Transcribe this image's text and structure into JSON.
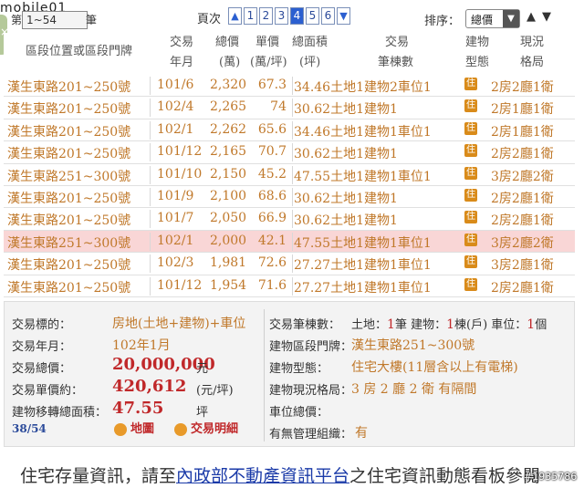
{
  "logo": "mobile01",
  "page_select": {
    "prefix": "第",
    "value": "1~54",
    "suffix": "筆"
  },
  "left_tab": "×",
  "pager": {
    "label": "頁次",
    "prev": "▲",
    "pages": [
      "1",
      "2",
      "3",
      "4",
      "5",
      "6"
    ],
    "current": "4",
    "next": "▼"
  },
  "sort": {
    "label": "排序：",
    "value": "總價",
    "arrow": "▼",
    "asc": "▲",
    "desc": "▼"
  },
  "headers": {
    "addr": "區段位置或區段門牌",
    "date_1": "交易",
    "date_2": "年月",
    "price_1": "總價",
    "price_2": "(萬)",
    "unit_1": "單價",
    "unit_2": "(萬/坪)",
    "area_1": "總面積",
    "area_2": "(坪)",
    "count_1": "交易",
    "count_2": "筆棟數",
    "type_1": "建物",
    "type_2": "型態",
    "layout_1": "現況",
    "layout_2": "格局"
  },
  "rows": [
    {
      "addr": "漢生東路201~250號",
      "date": "101/6",
      "price": "2,320",
      "unit": "67.3",
      "area": "34.46",
      "count": "土地1建物2車位1",
      "type": "住",
      "layout": "2房2廳1衛"
    },
    {
      "addr": "漢生東路201~250號",
      "date": "102/4",
      "price": "2,265",
      "unit": "74",
      "area": "30.62",
      "count": "土地1建物1",
      "type": "住",
      "layout": "2房1廳1衛"
    },
    {
      "addr": "漢生東路201~250號",
      "date": "102/1",
      "price": "2,262",
      "unit": "65.6",
      "area": "34.46",
      "count": "土地1建物1車位1",
      "type": "住",
      "layout": "2房1廳1衛"
    },
    {
      "addr": "漢生東路201~250號",
      "date": "101/12",
      "price": "2,165",
      "unit": "70.7",
      "area": "30.62",
      "count": "土地1建物1",
      "type": "住",
      "layout": "2房2廳1衛"
    },
    {
      "addr": "漢生東路251~300號",
      "date": "101/10",
      "price": "2,150",
      "unit": "45.2",
      "area": "47.55",
      "count": "土地1建物1車位1",
      "type": "住",
      "layout": "3房2廳2衛"
    },
    {
      "addr": "漢生東路201~250號",
      "date": "101/9",
      "price": "2,100",
      "unit": "68.6",
      "area": "30.62",
      "count": "土地1建物1",
      "type": "住",
      "layout": "2房2廳1衛"
    },
    {
      "addr": "漢生東路201~250號",
      "date": "101/7",
      "price": "2,050",
      "unit": "66.9",
      "area": "30.62",
      "count": "土地1建物1",
      "type": "住",
      "layout": "2房2廳1衛"
    },
    {
      "addr": "漢生東路251~300號",
      "date": "102/1",
      "price": "2,000",
      "unit": "42.1",
      "area": "47.55",
      "count": "土地1建物1車位1",
      "type": "住",
      "layout": "3房2廳2衛",
      "highlight": true
    },
    {
      "addr": "漢生東路201~250號",
      "date": "102/3",
      "price": "1,981",
      "unit": "72.6",
      "area": "27.27",
      "count": "土地1建物1車位1",
      "type": "住",
      "layout": "3房2廳1衛"
    },
    {
      "addr": "漢生東路201~250號",
      "date": "101/12",
      "price": "1,954",
      "unit": "71.6",
      "area": "27.27",
      "count": "土地1建物1車位1",
      "type": "住",
      "layout": "2房2廳1衛"
    }
  ],
  "detail": {
    "target_label": "交易標的：",
    "target_value": "房地(土地+建物)+車位",
    "month_label": "交易年月：",
    "month_value": "102年1月",
    "total_label": "交易總價：",
    "total_value": "20,000,000",
    "total_unit": "元",
    "unitp_label": "交易單價約：",
    "unitp_value": "420,612",
    "unitp_unit": "(元/坪)",
    "area_label": "建物移轉總面積：",
    "area_value": "47.55",
    "area_unit": "坪",
    "count_label": "交易筆棟數：",
    "count_value_1": "土地：",
    "count_value_1n": "1",
    "count_value_1u": "筆 建物：",
    "count_value_2n": "1",
    "count_value_2u": "棟(戶) 車位：",
    "count_value_3n": "1",
    "count_value_3u": "個",
    "door_label": "建物區段門牌：",
    "door_value": "漢生東路251~300號",
    "btype_label": "建物型態：",
    "btype_value": "住宅大樓(11層含以上有電梯)",
    "layout_label": "建物現況格局：",
    "layout_value": "3 房 2 廳 2 衛 有隔間",
    "park_label": "車位總價：",
    "park_value": "",
    "mgmt_label": "有無管理組織：",
    "mgmt_value": "有",
    "record_count": "38/54",
    "map_btn": "地圖",
    "detail_btn": "交易明細"
  },
  "footer": {
    "pre": "住宅存量資訊，請至",
    "link": "內政部不動產資訊平台",
    "post": "之住宅資訊動態看板參閱"
  },
  "watermark": "#1935786"
}
